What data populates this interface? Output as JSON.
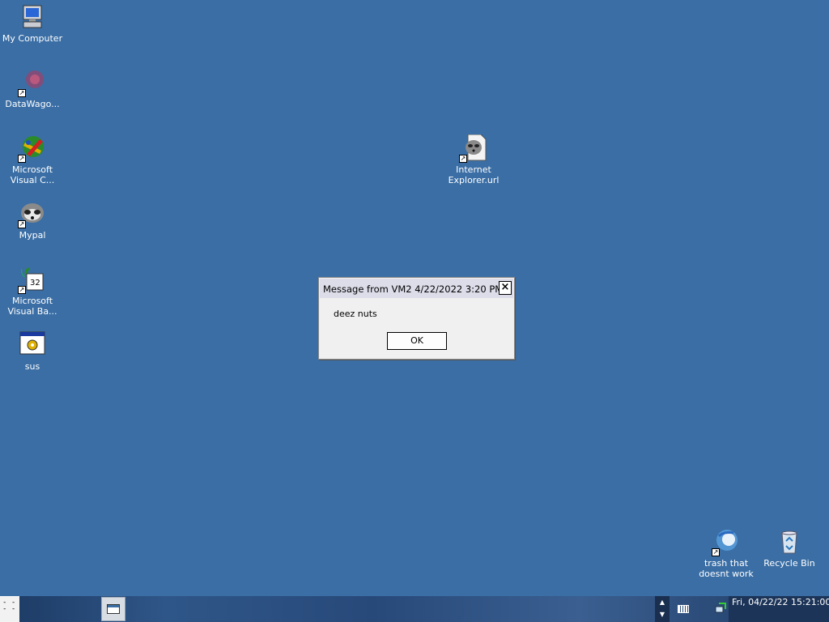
{
  "desktop": {
    "icons": [
      {
        "label": "My Computer",
        "icon": "computer-icon"
      },
      {
        "label": "DataWago...",
        "icon": "datawagon-icon"
      },
      {
        "label": "Microsoft Visual C...",
        "icon": "visual-cpp-icon"
      },
      {
        "label": "Mypal",
        "icon": "raccoon-icon"
      },
      {
        "label": "Microsoft Visual Ba...",
        "icon": "visual-basic-icon"
      },
      {
        "label": "sus",
        "icon": "program-icon"
      },
      {
        "label": "Internet Explorer.url",
        "icon": "url-file-icon"
      },
      {
        "label": "trash that doesnt work",
        "icon": "globe-shortcut-icon"
      },
      {
        "label": "Recycle Bin",
        "icon": "recycle-bin-icon"
      }
    ],
    "background_color": "#3a6ea5"
  },
  "dialog": {
    "title": "Message from VM2 4/22/2022 3:20 PM",
    "close_label": "×",
    "message": "deez nuts",
    "ok_label": "OK"
  },
  "taskbar": {
    "start_glyph": "- -\n- -",
    "scroll_up": "▲",
    "scroll_down": "▼",
    "clock": "Fri, 04/22/22 15:21:00"
  }
}
